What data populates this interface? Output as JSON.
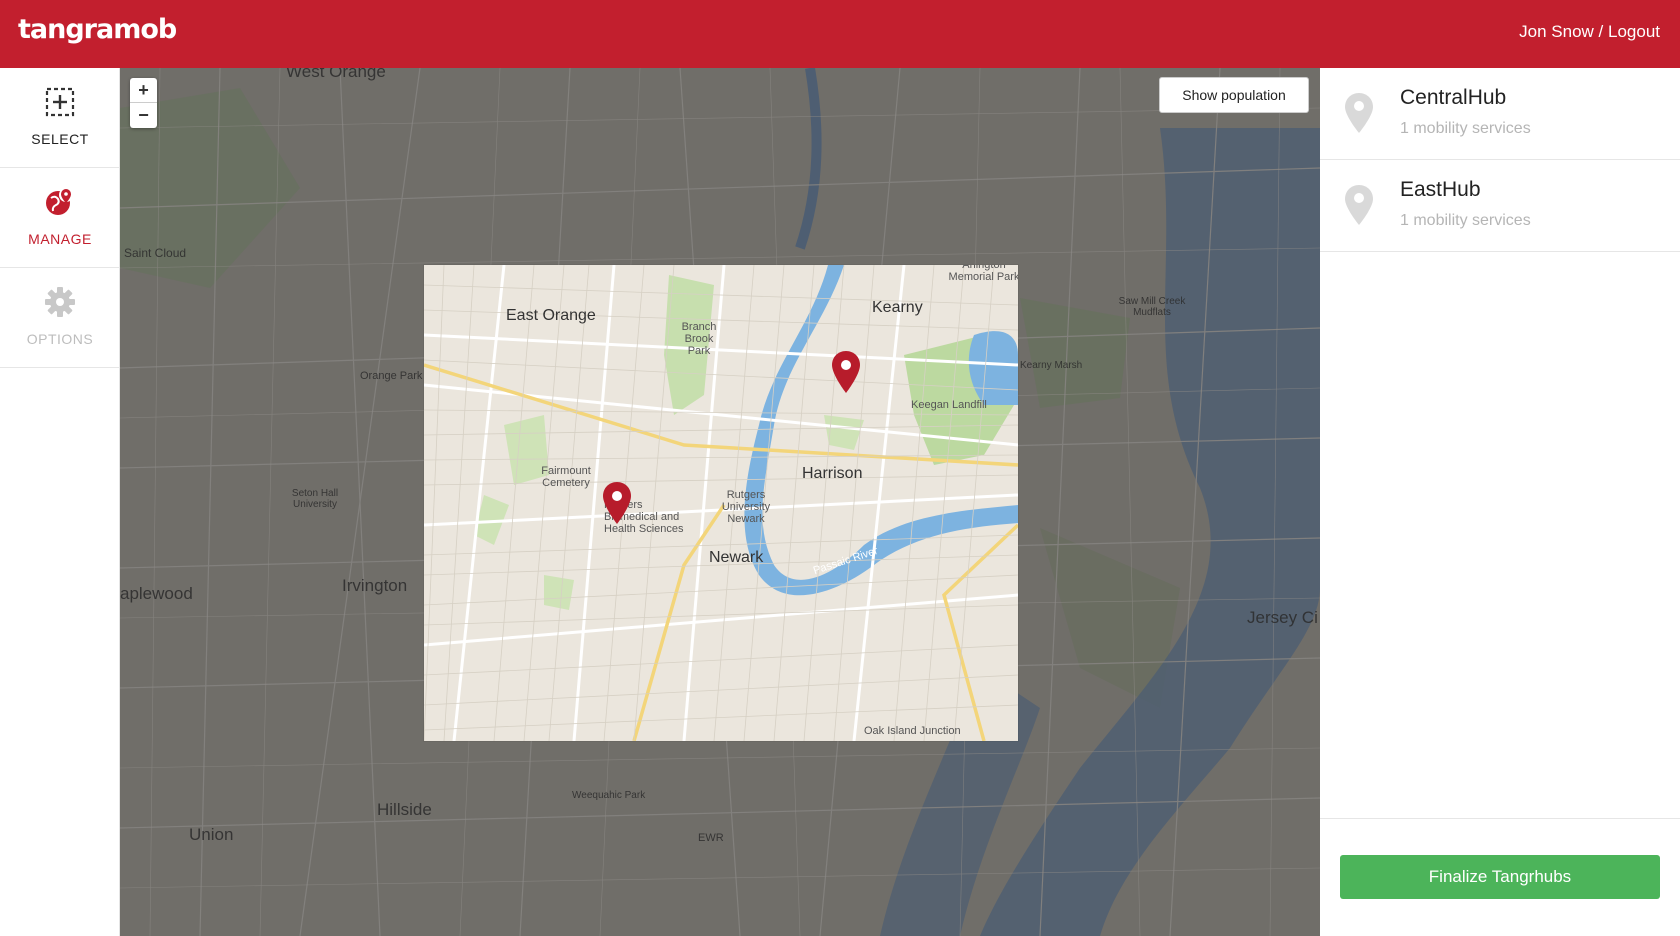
{
  "app": {
    "logo": "tangramob",
    "user_label": "Jon Snow / Logout",
    "brand_color": "#c21f2e",
    "accent_green": "#4cb45a"
  },
  "sidebar": {
    "items": [
      {
        "label": "SELECT",
        "icon": "select-area-icon",
        "state": "normal"
      },
      {
        "label": "MANAGE",
        "icon": "manage-globe-icon",
        "state": "active"
      },
      {
        "label": "OPTIONS",
        "icon": "gear-icon",
        "state": "disabled"
      }
    ]
  },
  "map": {
    "zoom_in": "+",
    "zoom_out": "−",
    "show_population": "Show population",
    "outside_labels": {
      "west_orange": "West Orange",
      "irvington": "Irvington",
      "maplewood": "aplewood",
      "hillside": "Hillside",
      "union": "Union",
      "jersey_city": "Jersey Ci",
      "saint_cloud": "Saint Cloud",
      "seton_hall": "Seton Hall University",
      "orange_park": "Orange Park",
      "ewr": "EWR",
      "kearny_marsh": "Kearny Marsh",
      "saw_mill": "Saw Mill Creek Mudflats",
      "weequahic": "Weequahic Park"
    },
    "inside_labels": {
      "east_orange": "East Orange",
      "kearny": "Kearny",
      "harrison": "Harrison",
      "newark": "Newark",
      "branch_brook": "Branch Brook Park",
      "fairmount": "Fairmount Cemetery",
      "rutgers_biomed": "Rutgers Biomedical and Health Sciences",
      "rutgers_newark": "Rutgers University Newark",
      "keegan": "Keegan Landfill",
      "arlington": "Arlington Memorial Park",
      "passaic_river": "Passaic River",
      "oak_island": "Oak Island Junction"
    }
  },
  "hubs": [
    {
      "name": "CentralHub",
      "services": "1 mobility services"
    },
    {
      "name": "EastHub",
      "services": "1 mobility services"
    }
  ],
  "finalize_label": "Finalize Tangrhubs"
}
